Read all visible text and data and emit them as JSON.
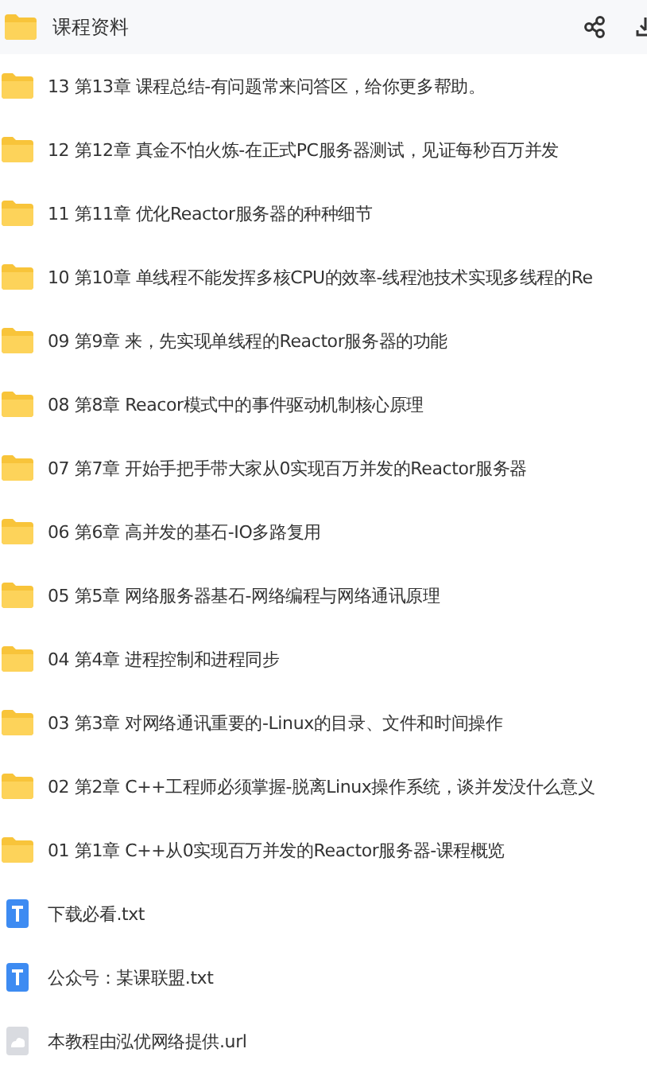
{
  "header": {
    "title": "课程资料"
  },
  "items": [
    {
      "kind": "folder",
      "name": "13 第13章 课程总结-有问题常来问答区，给你更多帮助。"
    },
    {
      "kind": "folder",
      "name": "12 第12章 真金不怕火炼-在正式PC服务器测试，见证每秒百万并发"
    },
    {
      "kind": "folder",
      "name": "11 第11章 优化Reactor服务器的种种细节"
    },
    {
      "kind": "folder",
      "name": "10 第10章 单线程不能发挥多核CPU的效率-线程池技术实现多线程的Re"
    },
    {
      "kind": "folder",
      "name": "09 第9章 来，先实现单线程的Reactor服务器的功能"
    },
    {
      "kind": "folder",
      "name": "08 第8章 Reacor模式中的事件驱动机制核心原理"
    },
    {
      "kind": "folder",
      "name": "07 第7章 开始手把手带大家从0实现百万并发的Reactor服务器"
    },
    {
      "kind": "folder",
      "name": "06 第6章 高并发的基石-IO多路复用"
    },
    {
      "kind": "folder",
      "name": "05 第5章 网络服务器基石-网络编程与网络通讯原理"
    },
    {
      "kind": "folder",
      "name": "04 第4章 进程控制和进程同步"
    },
    {
      "kind": "folder",
      "name": "03 第3章 对网络通讯重要的-Linux的目录、文件和时间操作"
    },
    {
      "kind": "folder",
      "name": "02 第2章 C++工程师必须掌握-脱离Linux操作系统，谈并发没什么意义"
    },
    {
      "kind": "folder",
      "name": "01 第1章 C++从0实现百万并发的Reactor服务器-课程概览"
    },
    {
      "kind": "txt",
      "name": "下载必看.txt"
    },
    {
      "kind": "txt",
      "name": "公众号：某课联盟.txt"
    },
    {
      "kind": "url",
      "name": "本教程由泓优网络提供.url"
    }
  ]
}
